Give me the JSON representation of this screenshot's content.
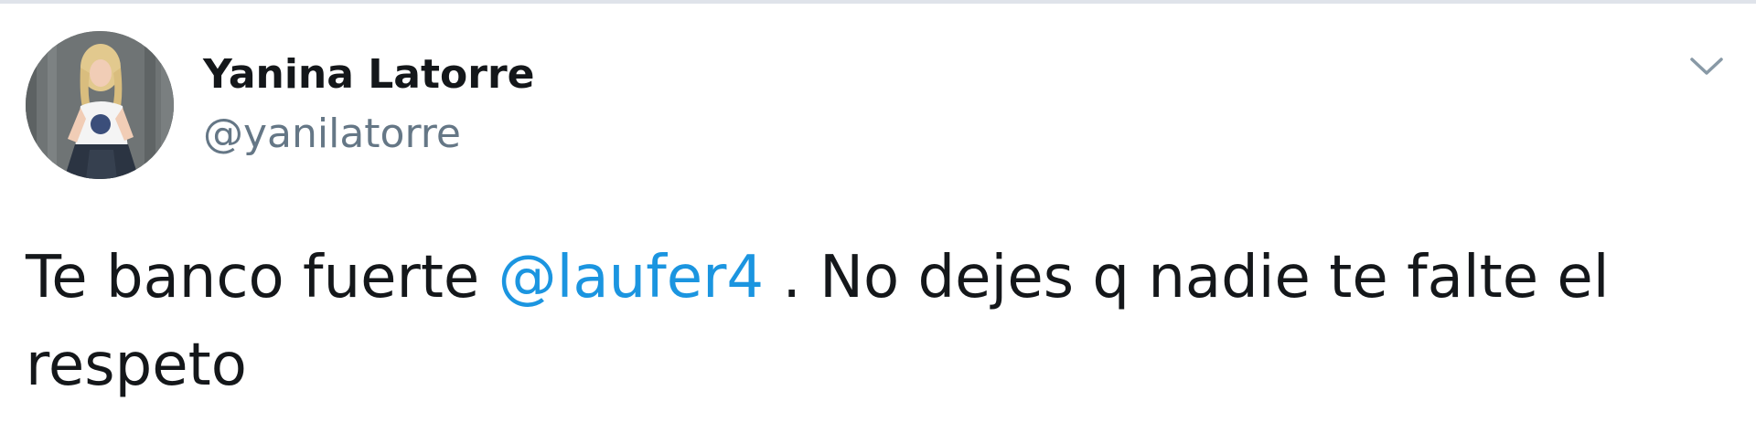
{
  "tweet": {
    "author": {
      "display_name": "Yanina Latorre",
      "handle": "@yanilatorre",
      "avatar_icon": "profile-photo"
    },
    "menu_icon": "chevron-down-icon",
    "text": {
      "before_mention": "Te banco fuerte ",
      "mention": "@laufer4",
      "after_mention": " . No dejes q nadie te falte el respeto"
    }
  },
  "colors": {
    "text_primary": "#14171a",
    "text_secondary": "#657786",
    "link": "#1b95e0",
    "chevron": "#8899a6",
    "top_border": "#dfe3ea"
  }
}
